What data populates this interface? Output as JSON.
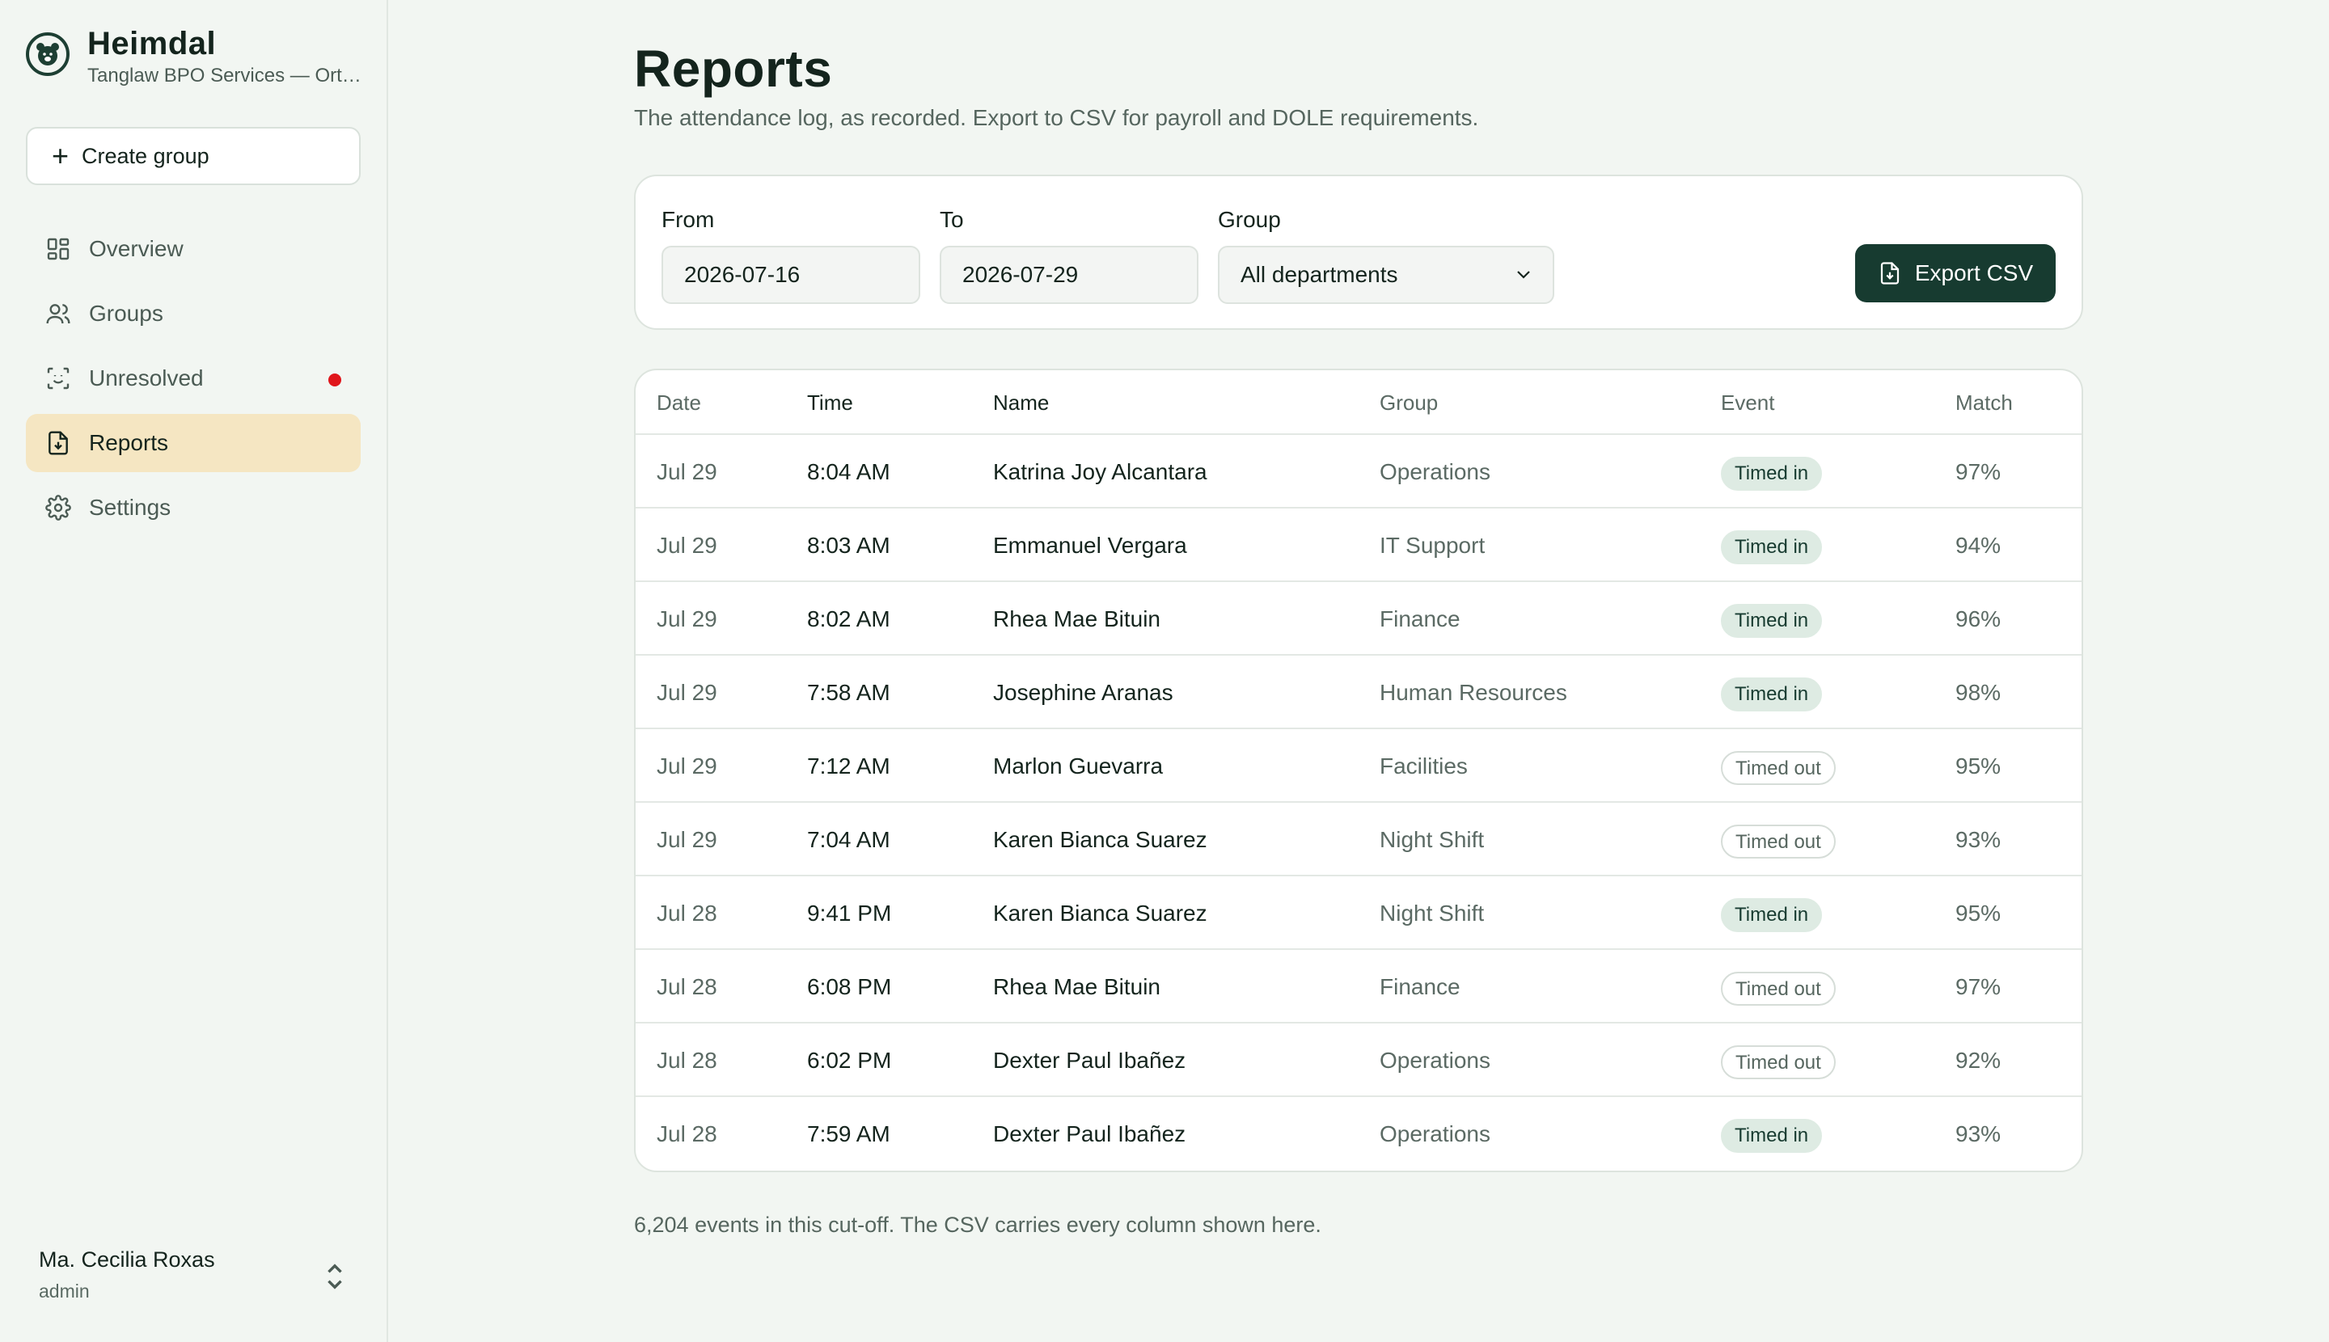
{
  "brand": {
    "name": "Heimdal",
    "org": "Tanglaw BPO Services — Ortigas"
  },
  "sidebar": {
    "create_label": "Create group",
    "items": [
      {
        "label": "Overview",
        "icon": "dashboard-icon"
      },
      {
        "label": "Groups",
        "icon": "users-icon"
      },
      {
        "label": "Unresolved",
        "icon": "face-scan-icon",
        "alert": true
      },
      {
        "label": "Reports",
        "icon": "report-file-icon",
        "active": true
      },
      {
        "label": "Settings",
        "icon": "gear-icon"
      }
    ]
  },
  "user": {
    "name": "Ma. Cecilia Roxas",
    "role": "admin"
  },
  "page": {
    "title": "Reports",
    "subtitle": "The attendance log, as recorded. Export to CSV for payroll and DOLE requirements."
  },
  "filters": {
    "from_label": "From",
    "from_value": "2026-07-16",
    "to_label": "To",
    "to_value": "2026-07-29",
    "group_label": "Group",
    "group_value": "All departments",
    "export_label": "Export CSV"
  },
  "table": {
    "headers": [
      "Date",
      "Time",
      "Name",
      "Group",
      "Event",
      "Match"
    ],
    "rows": [
      {
        "date": "Jul 29",
        "time": "8:04 AM",
        "name": "Katrina Joy Alcantara",
        "group": "Operations",
        "event": "Timed in",
        "match": "97%"
      },
      {
        "date": "Jul 29",
        "time": "8:03 AM",
        "name": "Emmanuel Vergara",
        "group": "IT Support",
        "event": "Timed in",
        "match": "94%"
      },
      {
        "date": "Jul 29",
        "time": "8:02 AM",
        "name": "Rhea Mae Bituin",
        "group": "Finance",
        "event": "Timed in",
        "match": "96%"
      },
      {
        "date": "Jul 29",
        "time": "7:58 AM",
        "name": "Josephine Aranas",
        "group": "Human Resources",
        "event": "Timed in",
        "match": "98%"
      },
      {
        "date": "Jul 29",
        "time": "7:12 AM",
        "name": "Marlon Guevarra",
        "group": "Facilities",
        "event": "Timed out",
        "match": "95%"
      },
      {
        "date": "Jul 29",
        "time": "7:04 AM",
        "name": "Karen Bianca Suarez",
        "group": "Night Shift",
        "event": "Timed out",
        "match": "93%"
      },
      {
        "date": "Jul 28",
        "time": "9:41 PM",
        "name": "Karen Bianca Suarez",
        "group": "Night Shift",
        "event": "Timed in",
        "match": "95%"
      },
      {
        "date": "Jul 28",
        "time": "6:08 PM",
        "name": "Rhea Mae Bituin",
        "group": "Finance",
        "event": "Timed out",
        "match": "97%"
      },
      {
        "date": "Jul 28",
        "time": "6:02 PM",
        "name": "Dexter Paul Ibañez",
        "group": "Operations",
        "event": "Timed out",
        "match": "92%"
      },
      {
        "date": "Jul 28",
        "time": "7:59 AM",
        "name": "Dexter Paul Ibañez",
        "group": "Operations",
        "event": "Timed in",
        "match": "93%"
      }
    ]
  },
  "footer": {
    "note": "6,204 events in this cut-off. The CSV carries every column shown here."
  },
  "colors": {
    "accent": "#173b30",
    "active_nav": "#f5e6c2",
    "alert": "#e0161b",
    "badge_in": "#deebe3"
  }
}
